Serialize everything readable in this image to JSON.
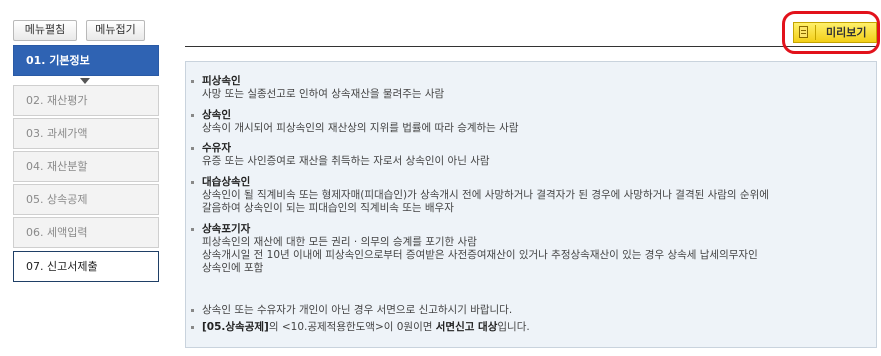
{
  "toolbar": {
    "expand": "메뉴펼침",
    "collapse": "메뉴접기",
    "preview": "미리보기"
  },
  "menu": [
    {
      "label": "01. 기본정보",
      "state": "active"
    },
    {
      "label": "02. 재산평가",
      "state": "disabled"
    },
    {
      "label": "03. 과세가액",
      "state": "disabled"
    },
    {
      "label": "04. 재산분할",
      "state": "disabled"
    },
    {
      "label": "05. 상속공제",
      "state": "disabled"
    },
    {
      "label": "06. 세액입력",
      "state": "disabled"
    },
    {
      "label": "07. 신고서제출",
      "state": "current"
    }
  ],
  "definitions": [
    {
      "term": "피상속인",
      "desc": [
        "사망 또는 실종선고로 인하여 상속재산을 물려주는 사람"
      ]
    },
    {
      "term": "상속인",
      "desc": [
        "상속이 개시되어 피상속인의 재산상의 지위를 법률에 따라 승계하는 사람"
      ]
    },
    {
      "term": "수유자",
      "desc": [
        "유증 또는 사인증여로 재산을 취득하는 자로서 상속인이 아닌 사람"
      ]
    },
    {
      "term": "대습상속인",
      "desc": [
        "상속인이 될 직계비속 또는 형제자매(피대습인)가 상속개시 전에 사망하거나 결격자가 된 경우에 사망하거나 결격된 사람의 순위에",
        "갈음하여 상속인이 되는 피대습인의 직계비속 또는 배우자"
      ]
    },
    {
      "term": "상속포기자",
      "desc": [
        "피상속인의 재산에 대한 모든 권리 · 의무의 승계를 포기한 사람",
        "상속개시일 전 10년 이내에 피상속인으로부터 증여받은 사전증여재산이 있거나 추정상속재산이 있는 경우 상속세 납세의무자인",
        "상속인에 포함"
      ]
    }
  ],
  "notes": {
    "note1": "상속인 또는 수유자가 개인이 아닌 경우 서면으로 신고하시기 바랍니다.",
    "note2": {
      "b1": "[05.상속공제]",
      "t1": "의 <10.공제적용한도액>이 0원이면 ",
      "b2": "서면신고 대상",
      "t2": "입니다."
    }
  },
  "colors": {
    "active_menu": "#2f63b3",
    "preview_button": "#f3cf18",
    "highlight_ring": "#e2121b",
    "panel_bg": "#eef3f8"
  }
}
